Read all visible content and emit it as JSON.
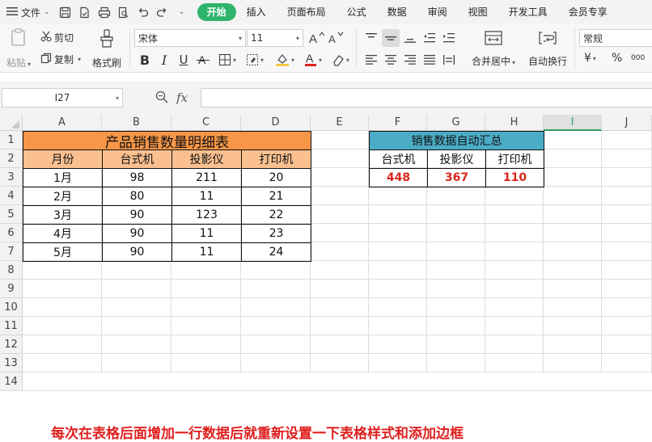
{
  "menubar": {
    "file_label": "文件",
    "tabs": [
      {
        "label": "开始",
        "active": true
      },
      {
        "label": "插入"
      },
      {
        "label": "页面布局"
      },
      {
        "label": "公式"
      },
      {
        "label": "数据"
      },
      {
        "label": "审阅"
      },
      {
        "label": "视图"
      },
      {
        "label": "开发工具"
      },
      {
        "label": "会员专享"
      }
    ]
  },
  "toolbar": {
    "paste_label": "粘贴",
    "cut_label": "剪切",
    "copy_label": "复制",
    "format_painter_label": "格式刷",
    "font_name": "宋体",
    "font_size": "11",
    "merge_center_label": "合并居中",
    "wrap_text_label": "自动换行",
    "number_format": "常规",
    "currency_symbol": "¥",
    "percent_symbol": "%",
    "comma_symbol": "000",
    "bold": "B",
    "italic": "I",
    "underline": "U",
    "font_color": "#e02020",
    "fill_color": "#f5c842"
  },
  "formula_bar": {
    "cell_ref": "I27",
    "fx_label": "fx",
    "formula": ""
  },
  "grid": {
    "columns": [
      "A",
      "B",
      "C",
      "D",
      "E",
      "F",
      "G",
      "H",
      "I",
      "J"
    ],
    "selected_column": "I",
    "rows": [
      "1",
      "2",
      "3",
      "4",
      "5",
      "6",
      "7",
      "8",
      "9",
      "10",
      "11",
      "12",
      "13",
      "14"
    ]
  },
  "product_table": {
    "title": "产品销售数量明细表",
    "title_color": "#f79646",
    "header_color": "#fac090",
    "headers": [
      "月份",
      "台式机",
      "投影仪",
      "打印机"
    ],
    "rows": [
      [
        "1月",
        "98",
        "211",
        "20"
      ],
      [
        "2月",
        "80",
        "11",
        "21"
      ],
      [
        "3月",
        "90",
        "123",
        "22"
      ],
      [
        "4月",
        "90",
        "11",
        "23"
      ],
      [
        "5月",
        "90",
        "11",
        "24"
      ]
    ]
  },
  "summary_table": {
    "title": "销售数据自动汇总",
    "title_color": "#4bacc6",
    "headers": [
      "台式机",
      "投影仪",
      "打印机"
    ],
    "values": [
      "448",
      "367",
      "110"
    ],
    "value_color": "#d9261c"
  },
  "annotation": {
    "text": "每次在表格后面增加一行数据后就重新设置一下表格样式和添加边框",
    "color": "#e02020"
  }
}
